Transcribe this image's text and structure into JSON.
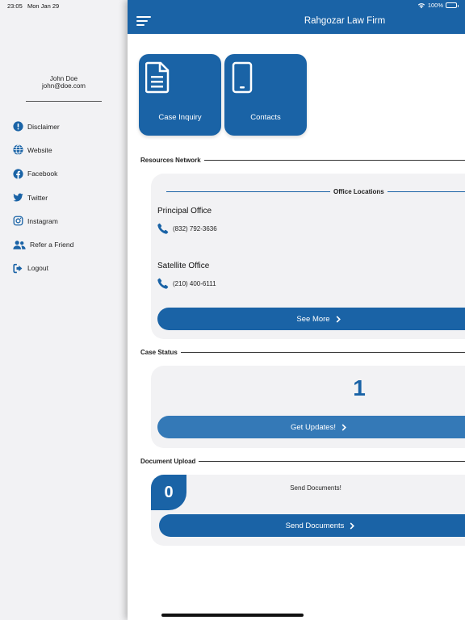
{
  "status_bar": {
    "time": "23:05",
    "date": "Mon Jan 29",
    "battery": "100%"
  },
  "sidebar": {
    "user_name": "John Doe",
    "user_email": "john@doe.com",
    "items": [
      {
        "label": "Disclaimer",
        "icon": "alert-circle-icon"
      },
      {
        "label": "Website",
        "icon": "globe-icon"
      },
      {
        "label": "Facebook",
        "icon": "facebook-icon"
      },
      {
        "label": "Twitter",
        "icon": "twitter-icon"
      },
      {
        "label": "Instagram",
        "icon": "instagram-icon"
      },
      {
        "label": "Refer a Friend",
        "icon": "users-icon"
      },
      {
        "label": "Logout",
        "icon": "logout-icon"
      }
    ]
  },
  "header": {
    "title": "Rahgozar Law Firm",
    "menu_icon": "hamburger-icon"
  },
  "tiles": [
    {
      "label": "Case Inquiry",
      "icon": "document-icon"
    },
    {
      "label": "Contacts",
      "icon": "phone-device-icon"
    }
  ],
  "resources": {
    "heading": "Resources Network",
    "locations_heading": "Office Locations",
    "offices": [
      {
        "name": "Principal Office",
        "phone": "(832) 792-3636"
      },
      {
        "name": "Satellite Office",
        "phone": "(210) 400-6111"
      }
    ],
    "see_more": "See More"
  },
  "case_status": {
    "heading": "Case Status",
    "count": "1",
    "button": "Get Updates!"
  },
  "document_upload": {
    "heading": "Document Upload",
    "count": "0",
    "title": "Send Documents!",
    "button": "Send Documents"
  },
  "colors": {
    "brand": "#1a63a6",
    "brand_light": "#3479b7",
    "card_bg": "#f2f2f4"
  }
}
